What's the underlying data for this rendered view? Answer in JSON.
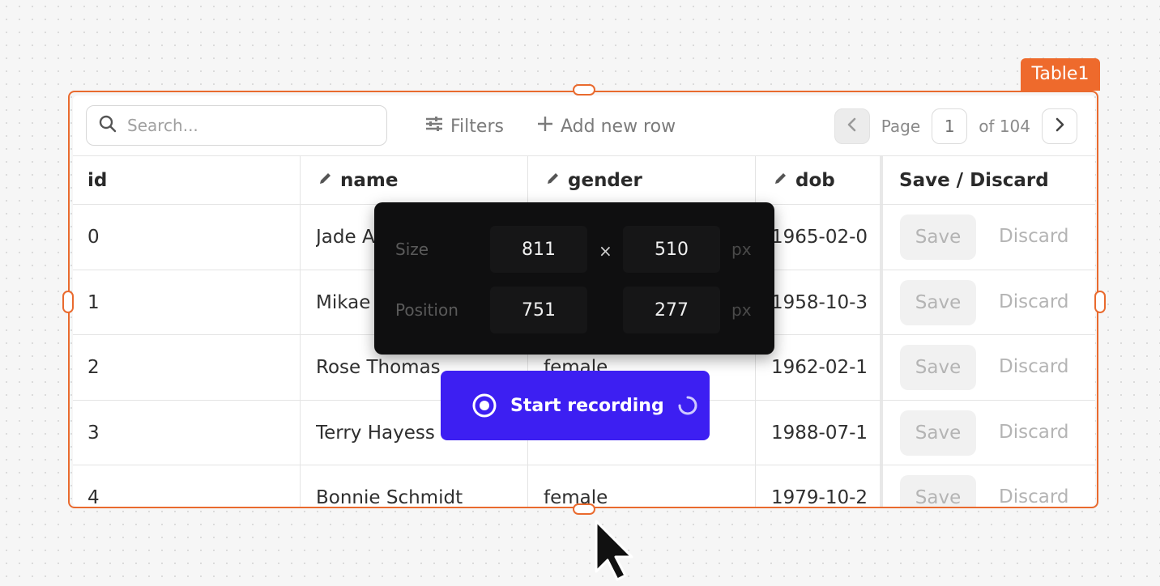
{
  "widget": {
    "name": "Table1"
  },
  "toolbar": {
    "search_placeholder": "Search...",
    "filters_label": "Filters",
    "add_row_label": "Add new row",
    "pager": {
      "page_label": "Page",
      "current_page": "1",
      "of_label": "of 104"
    }
  },
  "columns": [
    {
      "key": "id",
      "label": "id",
      "editable": false
    },
    {
      "key": "name",
      "label": "name",
      "editable": true
    },
    {
      "key": "gender",
      "label": "gender",
      "editable": true
    },
    {
      "key": "dob",
      "label": "dob",
      "editable": true
    },
    {
      "key": "actions",
      "label": "Save / Discard",
      "editable": false
    }
  ],
  "rows": [
    {
      "id": "0",
      "name": "Jade A",
      "gender": "",
      "dob": "1965-02-0"
    },
    {
      "id": "1",
      "name": "Mikae",
      "gender": "",
      "dob": "1958-10-3"
    },
    {
      "id": "2",
      "name": "Rose Thomas",
      "gender": "female",
      "dob": "1962-02-1"
    },
    {
      "id": "3",
      "name": "Terry Hayess",
      "gender": "",
      "dob": "1988-07-1"
    },
    {
      "id": "4",
      "name": "Bonnie Schmidt",
      "gender": "female",
      "dob": "1979-10-2"
    }
  ],
  "row_actions": {
    "save_label": "Save",
    "discard_label": "Discard"
  },
  "size_popup": {
    "size_label": "Size",
    "width": "811",
    "times": "×",
    "height": "510",
    "position_label": "Position",
    "pos_x": "751",
    "pos_y": "277",
    "unit": "px"
  },
  "record_button": {
    "label": "Start recording"
  },
  "colors": {
    "selection": "#e96a2e",
    "record_button": "#3d1ff2",
    "popup_bg": "#0f0f10"
  },
  "icons": [
    "search-icon",
    "filter-icon",
    "plus-icon",
    "chevron-left-icon",
    "chevron-right-icon",
    "pencil-icon",
    "record-icon",
    "spinner-icon",
    "cursor-icon"
  ]
}
